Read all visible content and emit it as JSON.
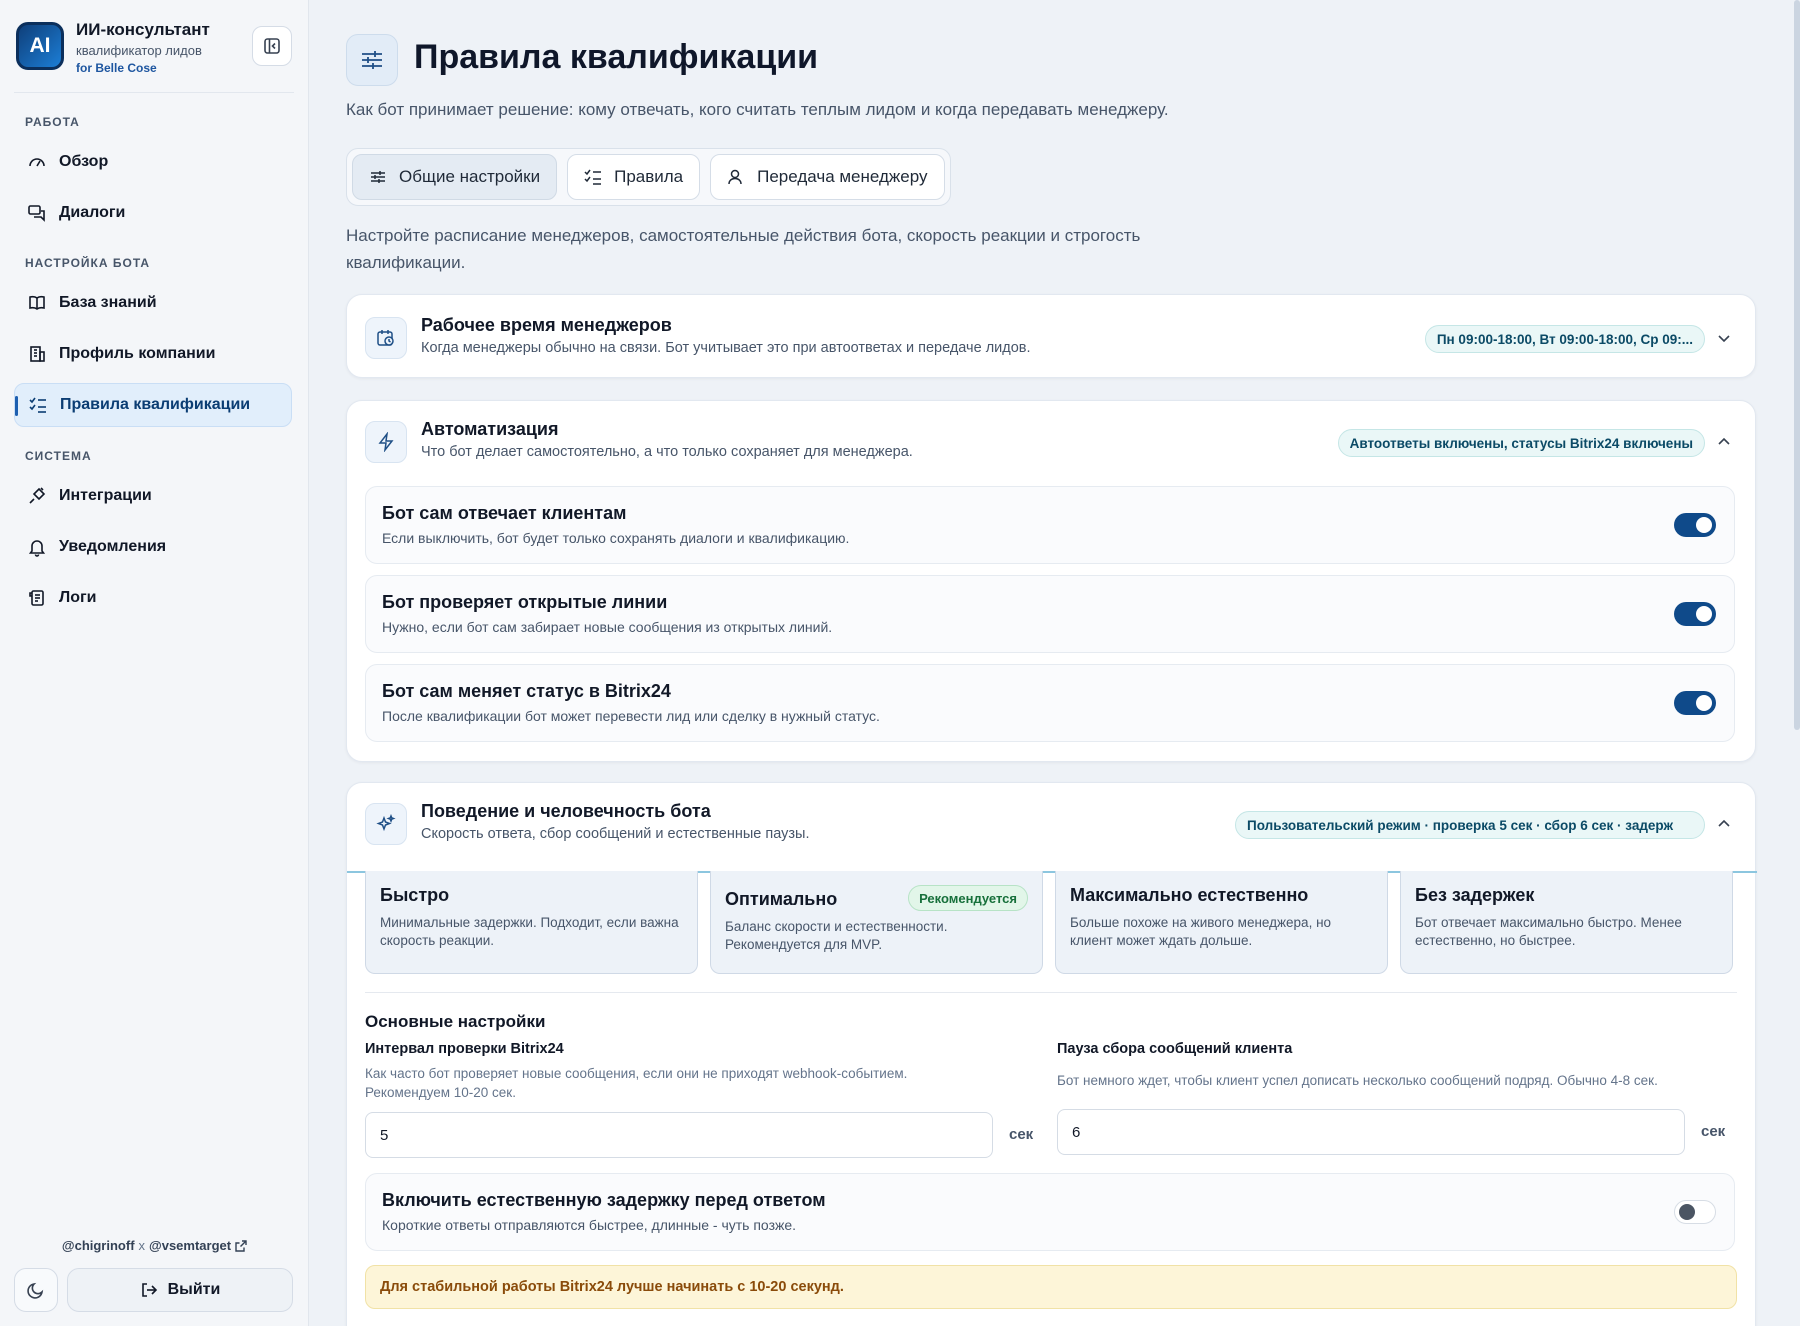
{
  "brand": {
    "logo": "AI",
    "title": "ИИ-консультант",
    "subtitle": "квалификатор лидов",
    "for": "for Belle Cose"
  },
  "nav": {
    "sections": [
      {
        "label": "РАБОТА",
        "items": [
          {
            "label": "Обзор",
            "icon": "gauge-icon"
          },
          {
            "label": "Диалоги",
            "icon": "chat-icon"
          }
        ]
      },
      {
        "label": "НАСТРОЙКА БОТА",
        "items": [
          {
            "label": "База знаний",
            "icon": "book-icon"
          },
          {
            "label": "Профиль компании",
            "icon": "building-icon"
          },
          {
            "label": "Правила квалификации",
            "icon": "list-check-icon",
            "active": true
          }
        ]
      },
      {
        "label": "СИСТЕМА",
        "items": [
          {
            "label": "Интеграции",
            "icon": "plug-icon"
          },
          {
            "label": "Уведомления",
            "icon": "bell-icon"
          },
          {
            "label": "Логи",
            "icon": "scroll-icon"
          }
        ]
      }
    ]
  },
  "footer": {
    "credit_a": "@chigrinoff",
    "credit_x": "x",
    "credit_b": "@vsemtarget",
    "logout": "Выйти"
  },
  "page": {
    "title": "Правила квалификации",
    "subtitle": "Как бот принимает решение: кому отвечать, кого считать теплым лидом и когда передавать менеджеру.",
    "tabs": [
      {
        "label": "Общие настройки",
        "active": true
      },
      {
        "label": "Правила"
      },
      {
        "label": "Передача менеджеру"
      }
    ],
    "description": "Настройте расписание менеджеров, самостоятельные действия бота, скорость реакции и строгость квалификации."
  },
  "work_hours": {
    "title": "Рабочее время менеджеров",
    "subtitle": "Когда менеджеры обычно на связи. Бот учитывает это при автоответах и передаче лидов.",
    "badge": "Пн 09:00-18:00, Вт 09:00-18:00, Ср 09:..."
  },
  "automation": {
    "title": "Автоматизация",
    "subtitle": "Что бот делает самостоятельно, а что только сохраняет для менеджера.",
    "badge": "Автоответы включены, статусы Bitrix24 включены",
    "rows": [
      {
        "title": "Бот сам отвечает клиентам",
        "subtitle": "Если выключить, бот будет только сохранять диалоги и квалификацию.",
        "on": true
      },
      {
        "title": "Бот проверяет открытые линии",
        "subtitle": "Нужно, если бот сам забирает новые сообщения из открытых линий.",
        "on": true
      },
      {
        "title": "Бот сам меняет статус в Bitrix24",
        "subtitle": "После квалификации бот может перевести лид или сделку в нужный статус.",
        "on": true
      }
    ]
  },
  "behavior": {
    "title": "Поведение и человечность бота",
    "subtitle": "Скорость ответа, сбор сообщений и естественные паузы.",
    "badge": "Пользовательский режим · проверка 5 сек · сбор 6 сек · задерж",
    "presets": [
      {
        "title": "Быстро",
        "desc": "Минимальные задержки. Подходит, если важна скорость реакции."
      },
      {
        "title": "Оптимально",
        "desc": "Баланс скорости и естественности. Рекомендуется для MVP.",
        "badge": "Рекомендуется"
      },
      {
        "title": "Максимально естественно",
        "desc": "Больше похоже на живого менеджера, но клиент может ждать дольше."
      },
      {
        "title": "Без задержек",
        "desc": "Бот отвечает максимально быстро. Менее естественно, но быстрее."
      }
    ],
    "basic_title": "Основные настройки",
    "interval": {
      "label": "Интервал проверки Bitrix24",
      "help": "Как часто бот проверяет новые сообщения, если они не приходят webhook-событием. Рекомендуем 10-20 сек.",
      "value": "5",
      "unit": "сек"
    },
    "pause": {
      "label": "Пауза сбора сообщений клиента",
      "help": "Бот немного ждет, чтобы клиент успел дописать несколько сообщений подряд. Обычно 4-8 сек.",
      "value": "6",
      "unit": "сек"
    },
    "delay_row": {
      "title": "Включить естественную задержку перед ответом",
      "subtitle": "Короткие ответы отправляются быстрее, длинные - чуть позже.",
      "on": false
    },
    "warning": "Для стабильной работы Bitrix24 лучше начинать с 10-20 секунд."
  }
}
